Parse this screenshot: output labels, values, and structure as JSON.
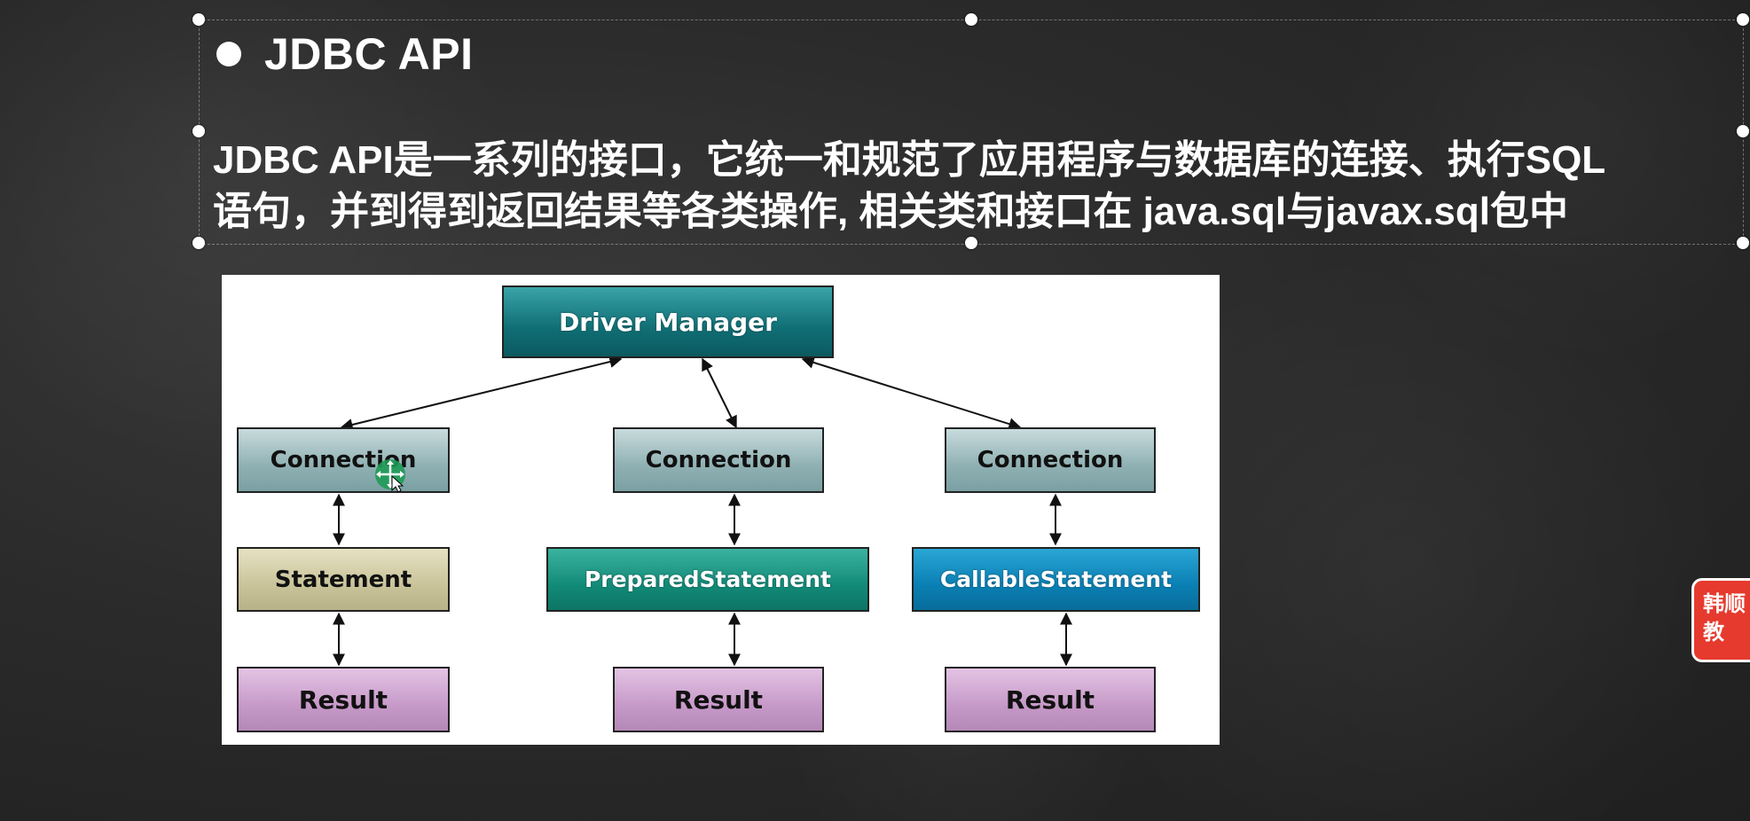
{
  "slide": {
    "heading": "JDBC API",
    "description_line1": "JDBC API是一系列的接口，它统一和规范了应用程序与数据库的连接、执行SQL",
    "description_line2": "语句，并到得到返回结果等各类操作, 相关类和接口在 java.sql与javax.sql包中"
  },
  "diagram": {
    "driver_manager": "Driver Manager",
    "columns": [
      {
        "connection": "Connection",
        "statement": "Statement",
        "result": "Result"
      },
      {
        "connection": "Connection",
        "statement": "PreparedStatement",
        "result": "Result"
      },
      {
        "connection": "Connection",
        "statement": "CallableStatement",
        "result": "Result"
      }
    ]
  },
  "side_tab": {
    "line1": "韩顺",
    "line2": "教"
  },
  "colors": {
    "driver_manager": "#0f6e74",
    "connection": "#8fb0b3",
    "statement": "#c9c39a",
    "prepared_statement": "#128a78",
    "callable_statement": "#0a7fb3",
    "result": "#c699c8",
    "side_tab": "#e63a2e"
  }
}
